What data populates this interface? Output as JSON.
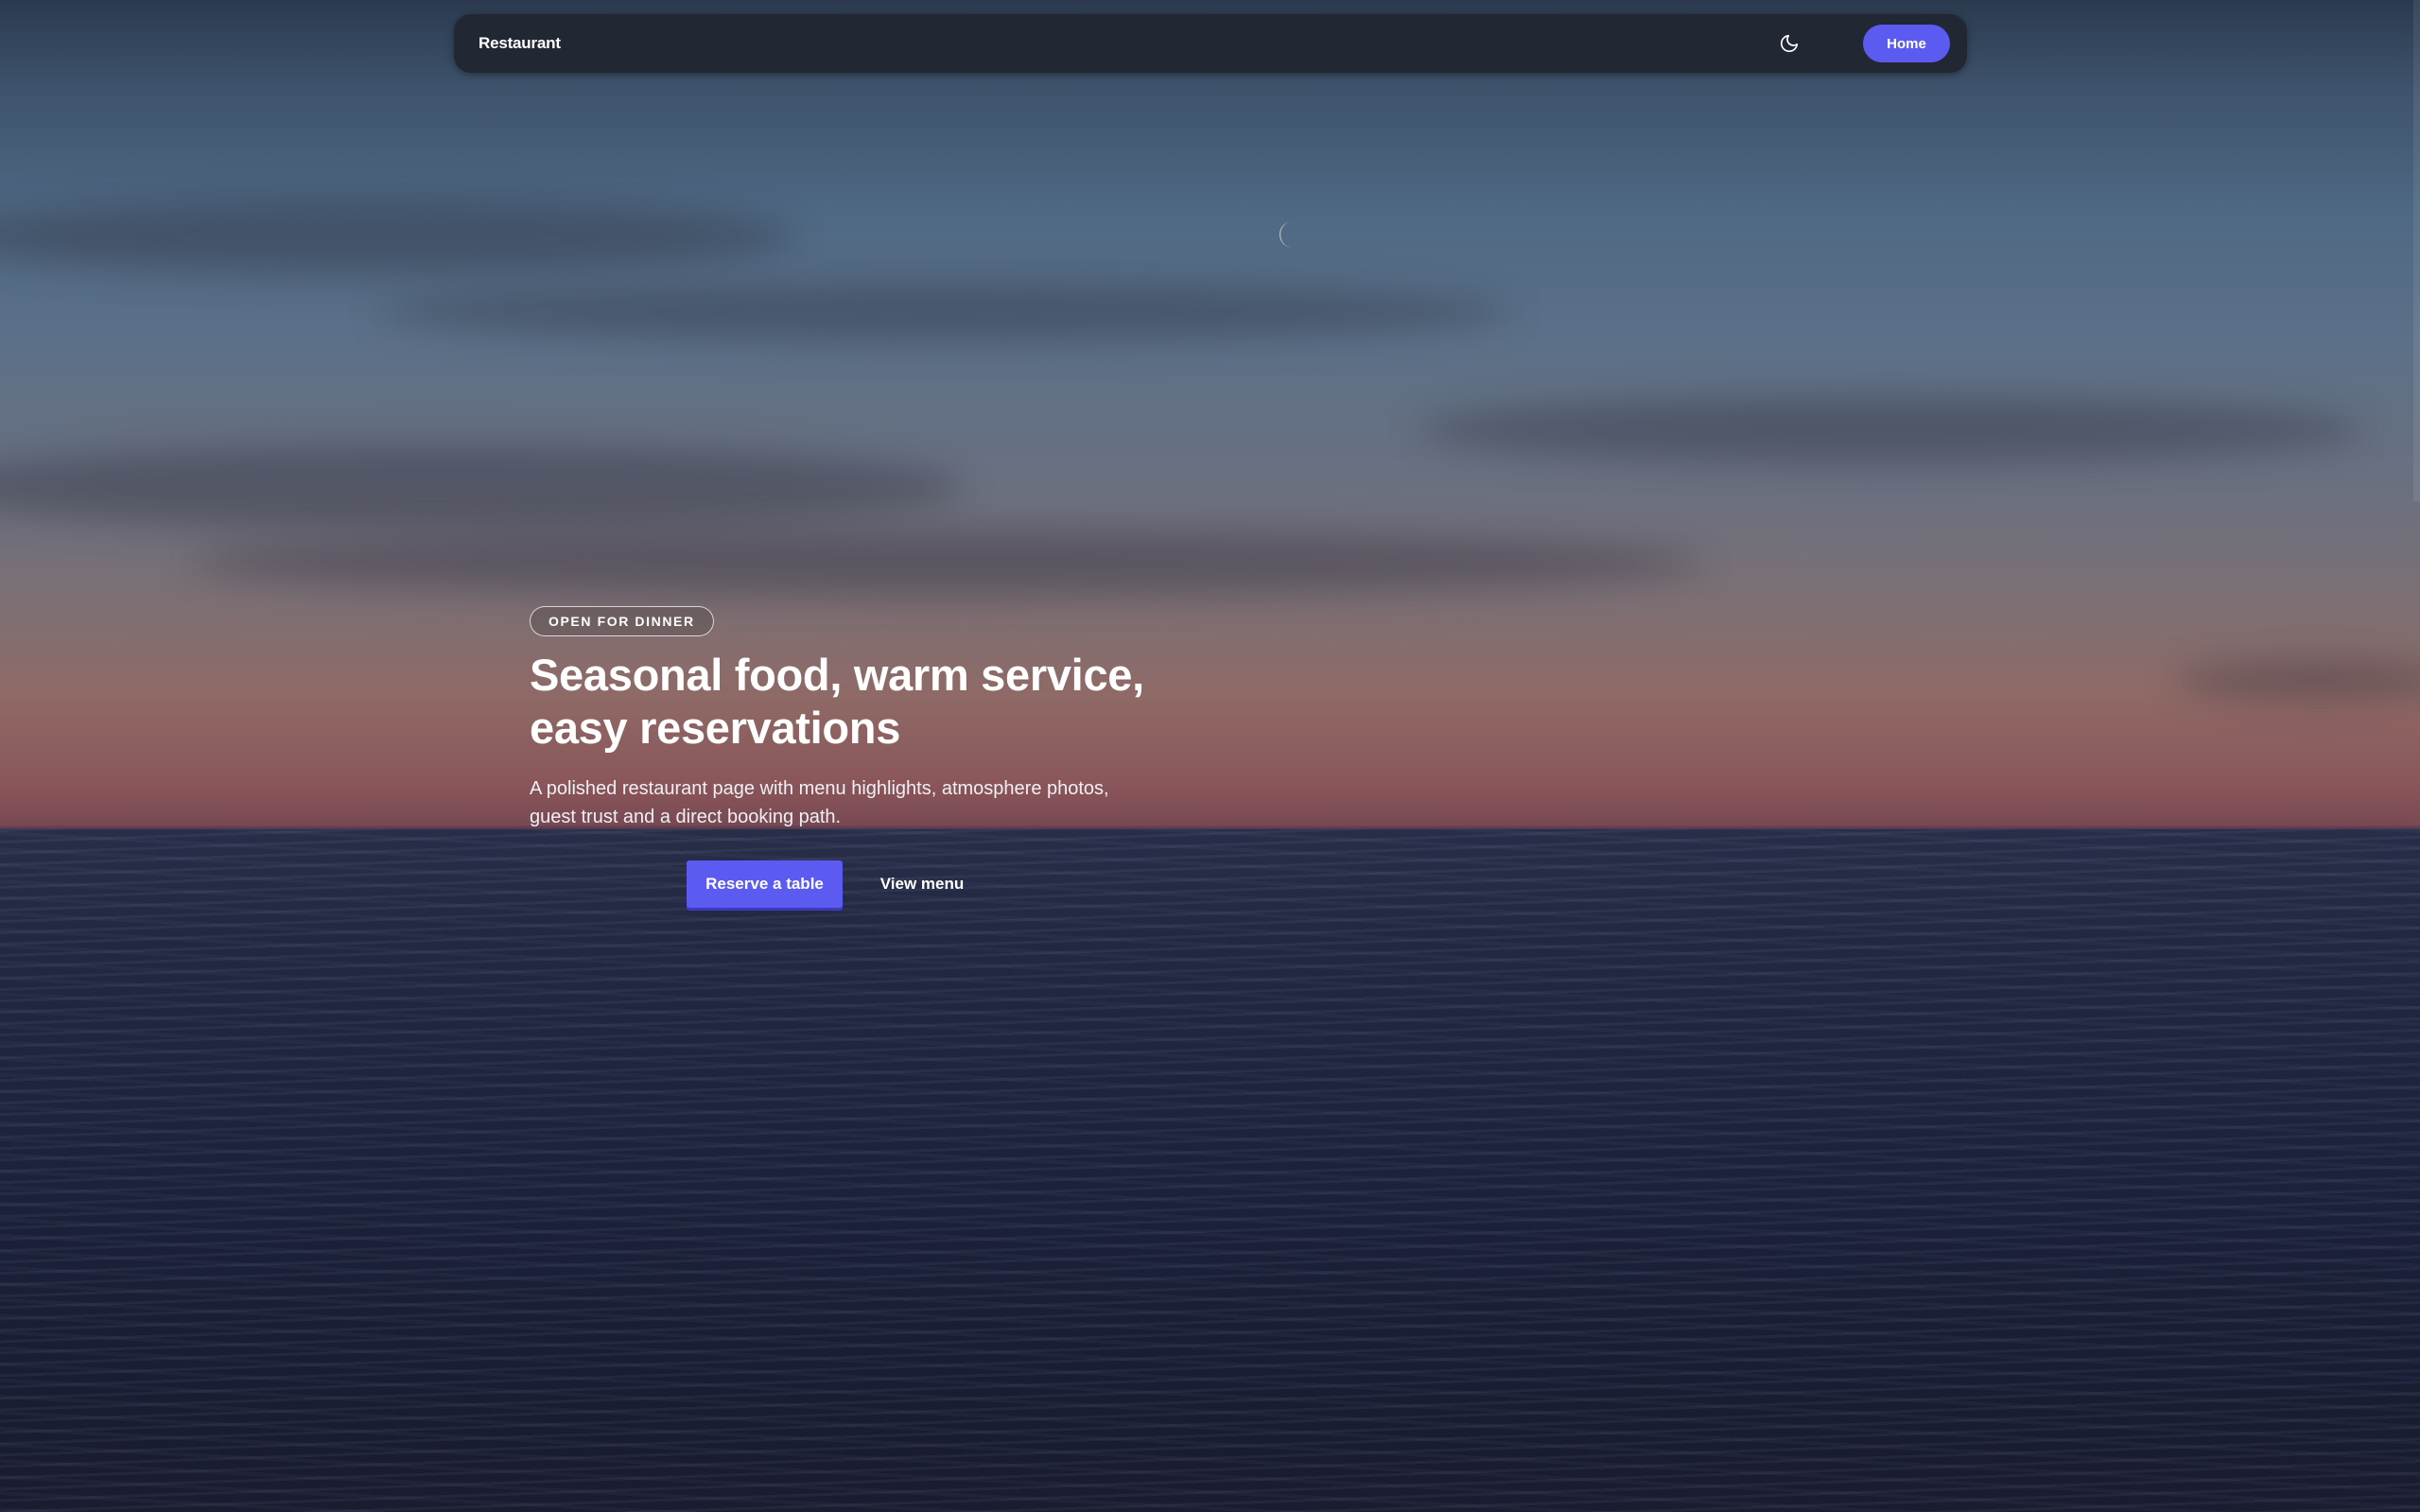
{
  "nav": {
    "brand": "Restaurant",
    "theme_icon": "moon-icon",
    "home_label": "Home"
  },
  "hero": {
    "badge": "OPEN FOR DINNER",
    "headline_line1": "Seasonal food, warm service,",
    "headline_line2": "easy reservations",
    "subtext_line1": "A polished restaurant page with menu highlights, atmosphere photos,",
    "subtext_line2": "guest trust and a direct booking path.",
    "primary_cta": "Reserve a table",
    "secondary_cta": "View menu"
  },
  "colors": {
    "accent": "#5b5bf2",
    "nav_background": "#222833",
    "text": "#ffffff"
  }
}
